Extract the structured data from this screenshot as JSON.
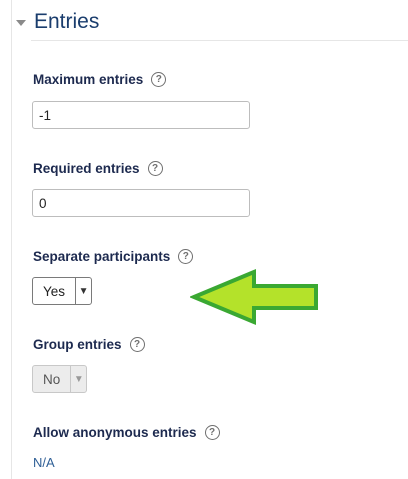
{
  "section": {
    "title": "Entries"
  },
  "fields": {
    "maximum_entries": {
      "label": "Maximum entries",
      "value": "-1"
    },
    "required_entries": {
      "label": "Required entries",
      "value": "0"
    },
    "separate_participants": {
      "label": "Separate participants",
      "selected": "Yes"
    },
    "group_entries": {
      "label": "Group entries",
      "selected": "No"
    },
    "allow_anonymous_entries": {
      "label": "Allow anonymous entries",
      "value": "N/A"
    }
  },
  "icons": {
    "collapse": "triangle-down-icon",
    "help": "question-circle-icon",
    "dropdown": "chevron-down-icon",
    "pointer_arrow": "arrow-left-icon"
  },
  "colors": {
    "title": "#1a3d6d",
    "label": "#1d2a4f",
    "link_value": "#2f5f96",
    "annotation_arrow_fill": "#b4e22a",
    "annotation_arrow_stroke": "#3aa832"
  }
}
